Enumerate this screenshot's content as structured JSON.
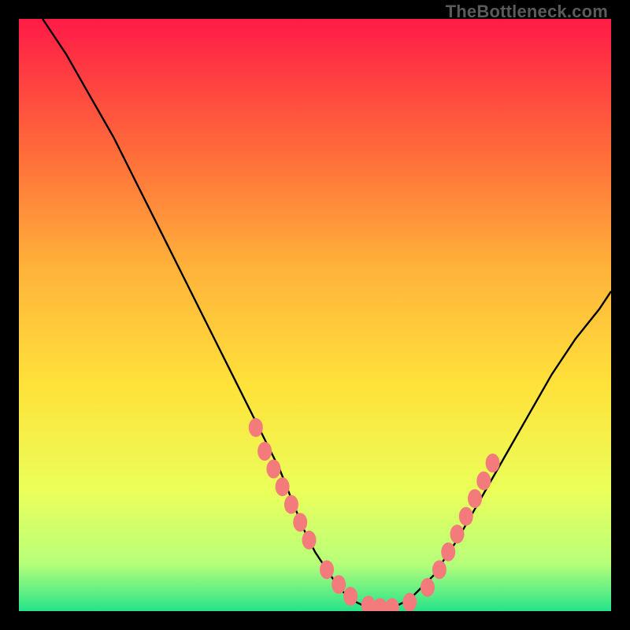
{
  "watermark": "TheBottleneck.com",
  "colors": {
    "gradient_top": "#ff1b47",
    "gradient_mid1": "#ff6a3a",
    "gradient_mid2": "#ffb23a",
    "gradient_mid3": "#ffe23a",
    "gradient_mid4": "#eaff5a",
    "gradient_mid5": "#b7ff7a",
    "gradient_bottom": "#25e38a",
    "curve": "#000000",
    "dot_fill": "#f47b7b",
    "dot_stroke": "#c94f4f",
    "frame_bg": "#000000"
  },
  "chart_data": {
    "type": "line",
    "title": "",
    "xlabel": "",
    "ylabel": "",
    "xlim": [
      0,
      100
    ],
    "ylim": [
      0,
      100
    ],
    "grid": false,
    "legend": false,
    "series": [
      {
        "name": "bottleneck-curve",
        "x": [
          4,
          8,
          12,
          16,
          20,
          24,
          28,
          32,
          36,
          40,
          44,
          48,
          50,
          52,
          54,
          56,
          58,
          60,
          62,
          64,
          66,
          70,
          74,
          78,
          82,
          86,
          90,
          94,
          98,
          100
        ],
        "y": [
          100,
          94,
          87,
          80,
          72,
          64,
          56,
          48,
          40,
          32,
          24,
          14,
          10,
          7,
          4,
          2,
          1,
          0.5,
          0.5,
          1,
          2,
          6,
          12,
          19,
          26,
          33,
          40,
          46,
          51,
          54
        ]
      }
    ],
    "highlight_points": {
      "name": "highlighted-dots",
      "x": [
        40,
        41.5,
        43,
        44.5,
        46,
        47.5,
        49,
        52,
        54,
        56,
        59,
        61,
        63,
        66,
        69,
        71,
        72.5,
        74,
        75.5,
        77,
        78.5,
        80
      ],
      "y": [
        31,
        27,
        24,
        21,
        18,
        15,
        12,
        7,
        4.5,
        2.5,
        1,
        0.6,
        0.6,
        1.5,
        4,
        7,
        10,
        13,
        16,
        19,
        22,
        25
      ]
    },
    "annotations": []
  }
}
